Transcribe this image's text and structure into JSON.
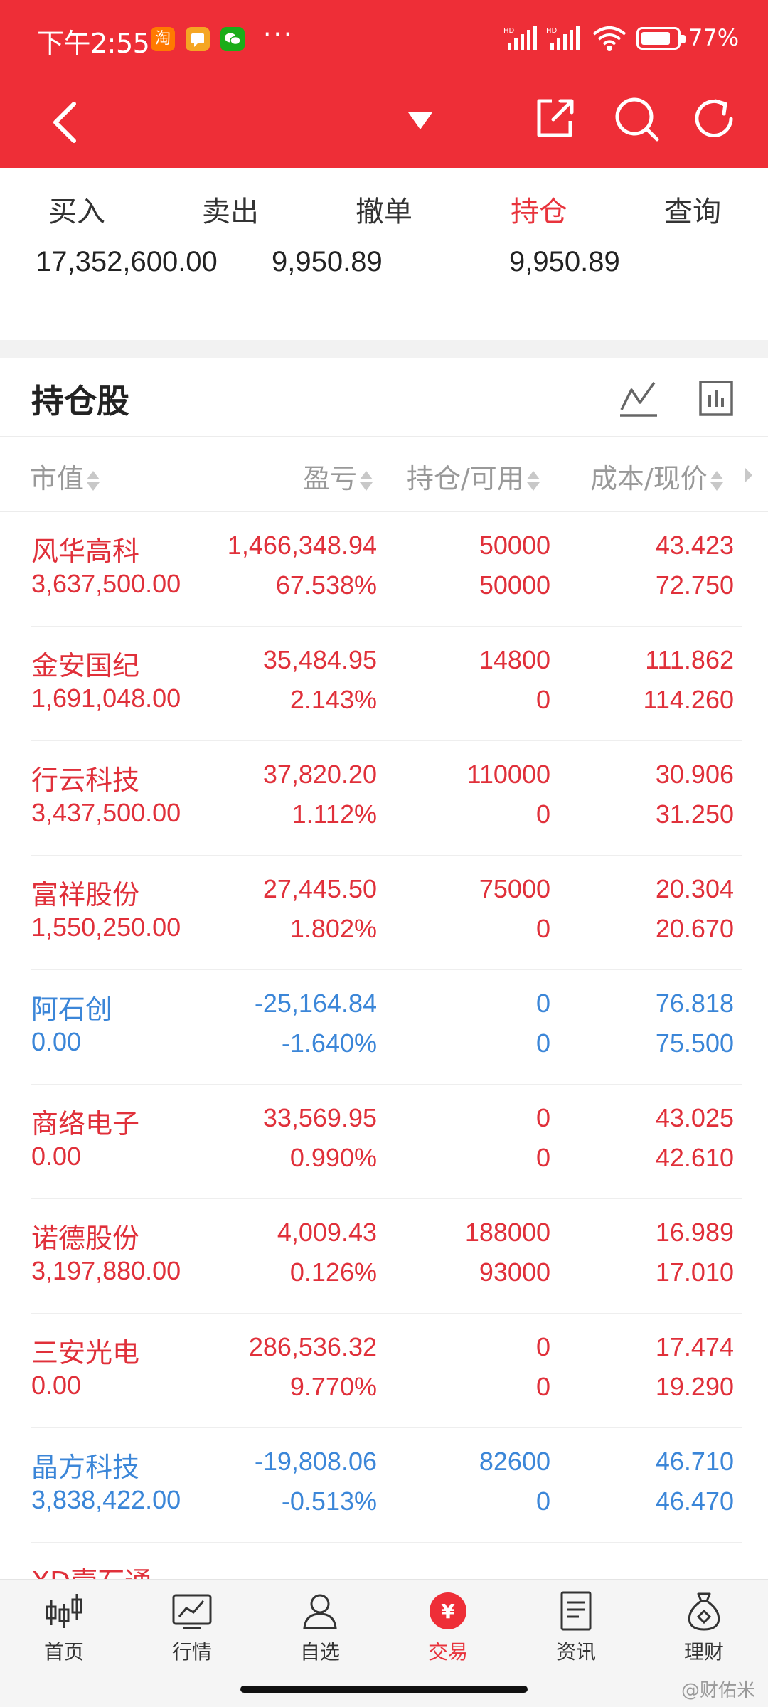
{
  "status_bar": {
    "time": "下午2:55",
    "app_icons": [
      "taobao-icon",
      "message-icon",
      "wechat-icon"
    ],
    "more": "···",
    "battery": "77%"
  },
  "nav": {
    "icons": [
      "back-icon",
      "dropdown-icon",
      "share-icon",
      "search-icon",
      "refresh-icon"
    ]
  },
  "tabs": [
    {
      "label": "买入"
    },
    {
      "label": "卖出"
    },
    {
      "label": "撤单"
    },
    {
      "label": "持仓",
      "active": true
    },
    {
      "label": "查询"
    }
  ],
  "summary": {
    "values": [
      "17,352,600.00",
      "9,950.89",
      "9,950.89"
    ]
  },
  "holdings": {
    "title": "持仓股",
    "columns": [
      "市值",
      "盈亏",
      "持仓/可用",
      "成本/现价"
    ],
    "rows": [
      {
        "name": "风华高科",
        "market_value": "3,637,500.00",
        "pnl": "1,466,348.94",
        "pnl_pct": "67.538%",
        "position": "50000",
        "available": "50000",
        "cost": "43.423",
        "price": "72.750",
        "color": "red"
      },
      {
        "name": "金安国纪",
        "market_value": "1,691,048.00",
        "pnl": "35,484.95",
        "pnl_pct": "2.143%",
        "position": "14800",
        "available": "0",
        "cost": "111.862",
        "price": "114.260",
        "color": "red"
      },
      {
        "name": "行云科技",
        "market_value": "3,437,500.00",
        "pnl": "37,820.20",
        "pnl_pct": "1.112%",
        "position": "110000",
        "available": "0",
        "cost": "30.906",
        "price": "31.250",
        "color": "red"
      },
      {
        "name": "富祥股份",
        "market_value": "1,550,250.00",
        "pnl": "27,445.50",
        "pnl_pct": "1.802%",
        "position": "75000",
        "available": "0",
        "cost": "20.304",
        "price": "20.670",
        "color": "red"
      },
      {
        "name": "阿石创",
        "market_value": "0.00",
        "pnl": "-25,164.84",
        "pnl_pct": "-1.640%",
        "position": "0",
        "available": "0",
        "cost": "76.818",
        "price": "75.500",
        "color": "blue"
      },
      {
        "name": "商络电子",
        "market_value": "0.00",
        "pnl": "33,569.95",
        "pnl_pct": "0.990%",
        "position": "0",
        "available": "0",
        "cost": "43.025",
        "price": "42.610",
        "color": "red"
      },
      {
        "name": "诺德股份",
        "market_value": "3,197,880.00",
        "pnl": "4,009.43",
        "pnl_pct": "0.126%",
        "position": "188000",
        "available": "93000",
        "cost": "16.989",
        "price": "17.010",
        "color": "red"
      },
      {
        "name": "三安光电",
        "market_value": "0.00",
        "pnl": "286,536.32",
        "pnl_pct": "9.770%",
        "position": "0",
        "available": "0",
        "cost": "17.474",
        "price": "19.290",
        "color": "red"
      },
      {
        "name": "晶方科技",
        "market_value": "3,838,422.00",
        "pnl": "-19,808.06",
        "pnl_pct": "-0.513%",
        "position": "82600",
        "available": "0",
        "cost": "46.710",
        "price": "46.470",
        "color": "blue"
      },
      {
        "name": "XD壹石通",
        "market_value": "",
        "pnl": "",
        "pnl_pct": "",
        "position": "",
        "available": "",
        "cost": "",
        "price": "",
        "color": "red"
      }
    ]
  },
  "bottom_nav": [
    {
      "label": "首页",
      "icon": "candlestick-icon"
    },
    {
      "label": "行情",
      "icon": "market-chart-icon"
    },
    {
      "label": "自选",
      "icon": "watchlist-person-icon"
    },
    {
      "label": "交易",
      "icon": "trade-yuan-icon",
      "active": true
    },
    {
      "label": "资讯",
      "icon": "news-document-icon"
    },
    {
      "label": "理财",
      "icon": "money-bag-icon"
    }
  ],
  "watermark": "@财佑米",
  "colors": {
    "accent": "#ee2e37",
    "gain": "#e0303a",
    "loss": "#3b86d8"
  }
}
